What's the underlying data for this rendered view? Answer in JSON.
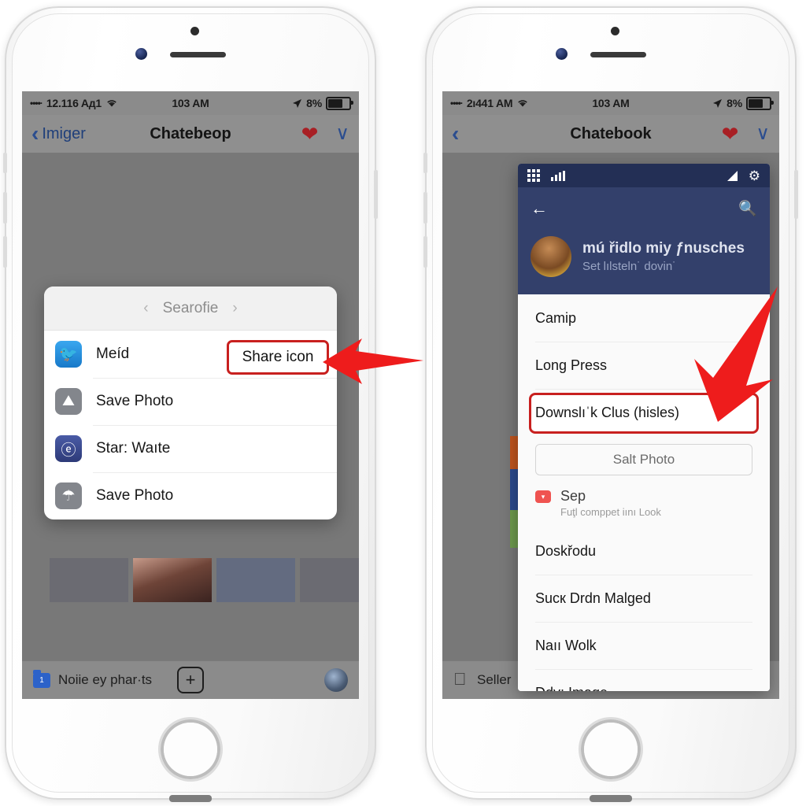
{
  "left_phone": {
    "status_bar": {
      "carrier_dots": "••••·",
      "carrier": "12.116 Aд1",
      "wifi_icon": "wifi-icon",
      "time": "103 AM",
      "location_icon": "location-arrow-icon",
      "battery_pct": "8%"
    },
    "nav_bar": {
      "back_label": "Imiger",
      "title": "Chatebeop",
      "heart_icon": "heart-icon",
      "send_icon": "send-icon"
    },
    "share_sheet": {
      "header_title": "Searofie",
      "prev_arrow": "‹",
      "next_arrow": "›",
      "rows": [
        {
          "label": "Meíd",
          "icon": "twitter-icon",
          "glyph": "🐦"
        },
        {
          "label": "Save Photo",
          "icon": "save-photo-icon",
          "glyph": "⛰"
        },
        {
          "label": "Star: Waıte",
          "icon": "app-circle-icon",
          "glyph": "ⓔ"
        },
        {
          "label": "Save Photo",
          "icon": "cloud-save-icon",
          "glyph": "☂"
        }
      ],
      "callout_label": "Share icon"
    },
    "toolbar": {
      "folder_icon": "folder-icon",
      "folder_badge": "1",
      "label": "Noiie ey phar·ts",
      "plus_icon": "plus-icon",
      "avatar": "user-avatar"
    }
  },
  "right_phone": {
    "status_bar": {
      "carrier_dots": "••••·",
      "carrier": "2ı441 AM",
      "wifi_icon": "wifi-icon",
      "time": "103 AM",
      "location_icon": "location-arrow-icon",
      "battery_pct": "8%"
    },
    "nav_bar": {
      "back_label": "",
      "title": "Chatebook",
      "heart_icon": "heart-icon",
      "send_icon": "send-icon"
    },
    "app_sheet": {
      "sys_bar": {
        "grid_icon": "grid-icon",
        "signal_icon": "signal-bars-icon",
        "triangle_icon": "triangle-icon",
        "gear_icon": "gear-icon"
      },
      "app_bar": {
        "back_icon": "back-arrow-icon",
        "search_icon": "search-icon"
      },
      "profile": {
        "avatar": "profile-avatar",
        "name": "mú řidlo miy ƒnusches",
        "subtitle": "Set lılsteln˙ dovin˙"
      },
      "items": [
        {
          "label": "Camip",
          "chevron": ""
        },
        {
          "label": "Long Press",
          "chevron": "›"
        },
        {
          "label": "Downslıˈk Clus (hisles)",
          "chevron": "",
          "highlight": true
        }
      ],
      "salt_button": "Salt Photo",
      "sep": {
        "title": "Sep",
        "subtitle": "Fuţl comppet iını Look",
        "icon": "red-badge-icon"
      },
      "items2": [
        {
          "label": "Doskřodu"
        },
        {
          "label": "Sucк Drdn Malged"
        },
        {
          "label": "Naıı Wolk"
        },
        {
          "label": "Ddv: Image"
        }
      ]
    },
    "toolbar": {
      "apple_icon": "apple-icon",
      "label": "Seller"
    }
  },
  "annotations": {
    "left_arrow_name": "red-arrow-left",
    "right_arrow_name": "red-arrow-down",
    "highlight_color": "#c8201f"
  }
}
